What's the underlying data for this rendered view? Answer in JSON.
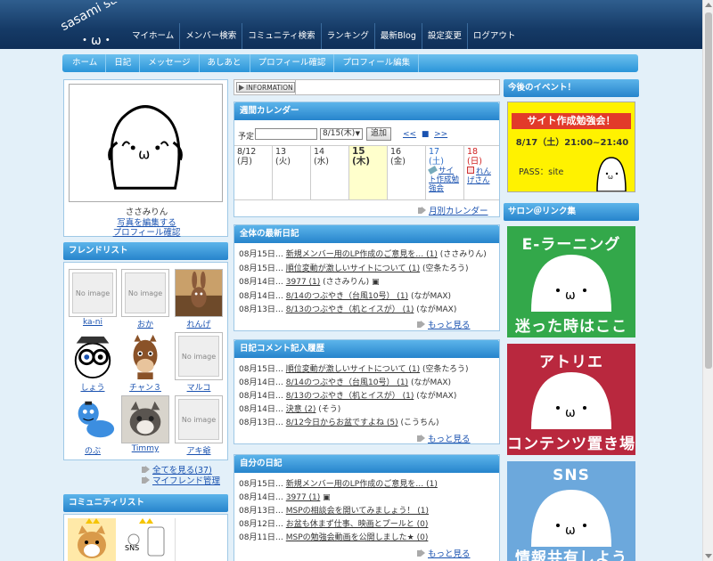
{
  "header": {
    "logo_text": "sasami salon",
    "nav": [
      "マイホーム",
      "メンバー検索",
      "コミュニティ検索",
      "ランキング",
      "最新Blog",
      "設定変更",
      "ログアウト"
    ]
  },
  "subnav": [
    "ホーム",
    "日記",
    "メッセージ",
    "あしあと",
    "プロフィール確認",
    "プロフィール編集"
  ],
  "profile": {
    "name": "ささみりん",
    "edit_photo": "写真を編集する",
    "check_profile": "プロフィール確認"
  },
  "friends": {
    "title": "フレンドリスト",
    "noimage": "No image",
    "items": [
      "ka-ni",
      "おか",
      "れんげ",
      "しょう",
      "チャン３",
      "マルコ",
      "のぶ",
      "Timmy",
      "アキ爺"
    ],
    "see_all": "全てを見る(37)",
    "manage": "マイフレンド管理"
  },
  "community": {
    "title": "コミュニティリスト"
  },
  "information": {
    "label": "INFORMATION"
  },
  "calendar": {
    "title": "週間カレンダー",
    "yotei": "予定",
    "date_select": "8/15(木)",
    "add": "追加",
    "prev": "<<",
    "current": "■",
    "next": ">>",
    "days": [
      {
        "d": "8/12",
        "w": "(月)"
      },
      {
        "d": "13",
        "w": "(火)"
      },
      {
        "d": "14",
        "w": "(水)"
      },
      {
        "d": "15",
        "w": "(木)"
      },
      {
        "d": "16",
        "w": "(金)"
      },
      {
        "d": "17",
        "w": "(土)"
      },
      {
        "d": "18",
        "w": "(日)"
      }
    ],
    "event_sat": "サイト作成勉強会",
    "event_sun": "れんげさん",
    "monthly": "月別カレンダー"
  },
  "latest_diary": {
    "title": "全体の最新日記",
    "items": [
      {
        "date": "08月15日…",
        "title": "新規メンバー用のLP作成のご意見を… (1)",
        "author": "(ささみりん)"
      },
      {
        "date": "08月15日…",
        "title": "順位変動が激しいサイトについて (1)",
        "author": "(空条たろう)"
      },
      {
        "date": "08月14日…",
        "title": "3977 (1)",
        "author": "(ささみりん)"
      },
      {
        "date": "08月14日…",
        "title": "8/14のつぶやき（台風10号） (1)",
        "author": "(ながMAX)"
      },
      {
        "date": "08月13日…",
        "title": "8/13のつぶやき（机とイスが） (1)",
        "author": "(ながMAX)"
      }
    ],
    "more": "もっと見る"
  },
  "comment_history": {
    "title": "日記コメント記入履歴",
    "items": [
      {
        "date": "08月15日…",
        "title": "順位変動が激しいサイトについて (1)",
        "author": "(空条たろう)"
      },
      {
        "date": "08月14日…",
        "title": "8/14のつぶやき（台風10号） (1)",
        "author": "(ながMAX)"
      },
      {
        "date": "08月14日…",
        "title": "8/13のつぶやき（机とイスが） (1)",
        "author": "(ながMAX)"
      },
      {
        "date": "08月14日…",
        "title": "決意 (2)",
        "author": "(そう)"
      },
      {
        "date": "08月13日…",
        "title": "8/12今日からお盆ですよね (5)",
        "author": "(こうちん)"
      }
    ],
    "more": "もっと見る"
  },
  "my_diary": {
    "title": "自分の日記",
    "items": [
      {
        "date": "08月15日…",
        "title": "新規メンバー用のLP作成のご意見を… (1)"
      },
      {
        "date": "08月14日…",
        "title": "3977 (1)"
      },
      {
        "date": "08月13日…",
        "title": "MSPの相談会を開いてみましょう！ (1)"
      },
      {
        "date": "08月12日…",
        "title": "お盆も休まず仕事、映画とプールと (0)"
      },
      {
        "date": "08月11日…",
        "title": "MSPの勉強会動画を公開しました★ (0)"
      }
    ],
    "more": "もっと見る"
  },
  "events": {
    "title": "今後のイベント！",
    "banner_title": "サイト作成勉強会！",
    "banner_time": "8/17（土）21:00~21:40",
    "banner_pass": "PASS：site"
  },
  "links": {
    "title": "サロン＠リンク集",
    "b1_top": "E-ラーニング",
    "b1_bottom": "迷った時はここ",
    "b2_top": "アトリエ",
    "b2_bottom": "コンテンツ置き場",
    "b3_top": "SNS",
    "b3_bottom": "情報共有しよう"
  },
  "colors": {
    "green": "#33a84a",
    "red": "#b9283e",
    "blue": "#6ca8dc",
    "yellow": "#fff200",
    "header": "#153a66",
    "accent": "#2b95d9"
  }
}
